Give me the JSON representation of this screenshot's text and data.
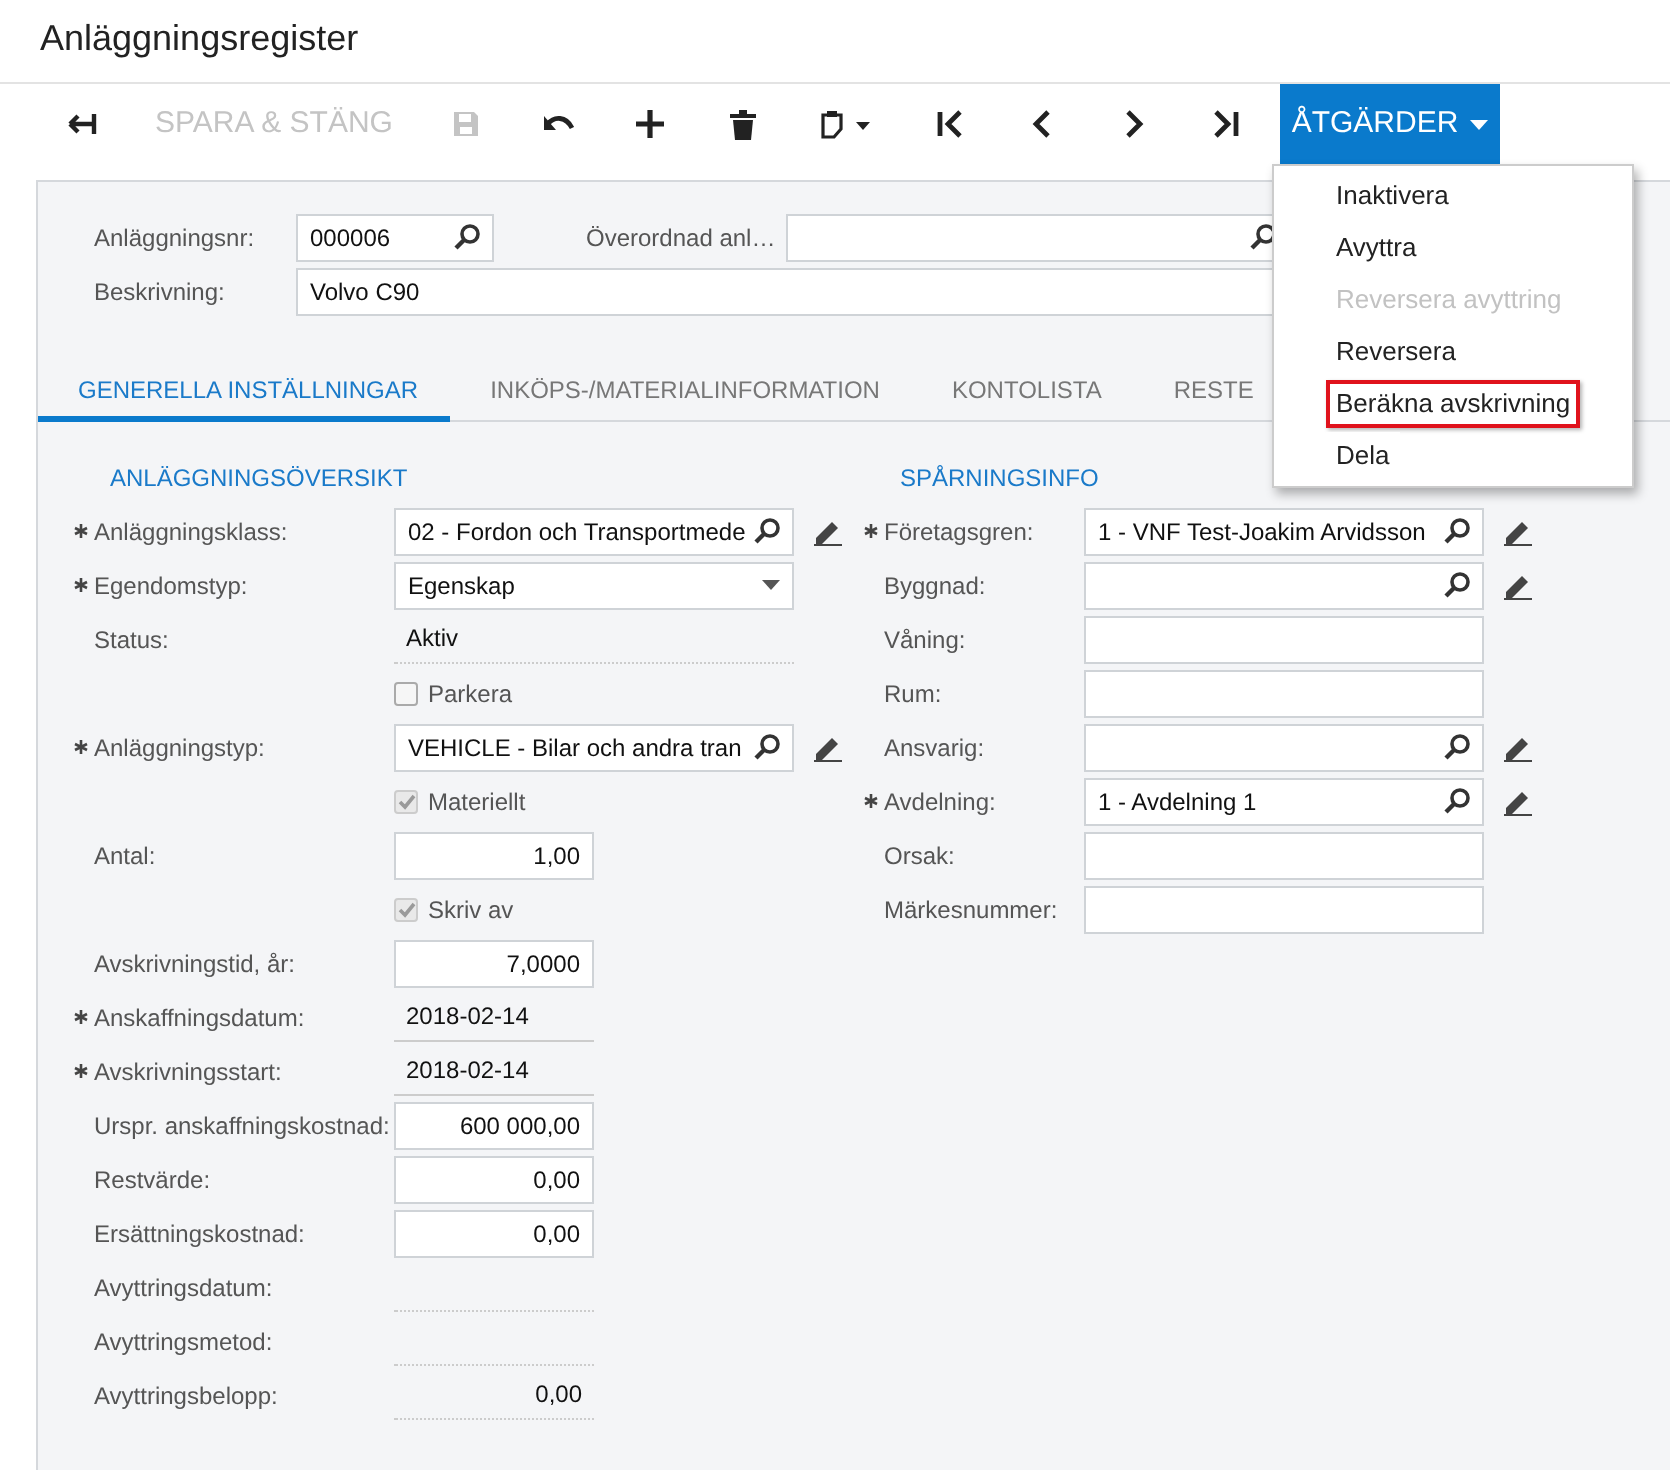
{
  "page_title": "Anläggningsregister",
  "toolbar": [
    {
      "kind": "back",
      "disabled": false
    },
    {
      "kind": "text",
      "label": "SPARA & STÄNG",
      "disabled": true
    },
    {
      "kind": "save",
      "disabled": true
    },
    {
      "kind": "undo",
      "disabled": false
    },
    {
      "kind": "add",
      "disabled": false
    },
    {
      "kind": "delete",
      "disabled": false
    },
    {
      "kind": "clipboard",
      "disabled": false
    },
    {
      "kind": "first",
      "disabled": false
    },
    {
      "kind": "prev",
      "disabled": false
    },
    {
      "kind": "next",
      "disabled": false
    },
    {
      "kind": "last",
      "disabled": false
    },
    {
      "kind": "menu",
      "label": "ÅTGÄRDER",
      "expanded": true
    }
  ],
  "actions_menu": [
    {
      "label": "Inaktivera",
      "disabled": false,
      "highlighted": false
    },
    {
      "label": "Avyttra",
      "disabled": false,
      "highlighted": false
    },
    {
      "label": "Reversera avyttring",
      "disabled": true,
      "highlighted": false
    },
    {
      "label": "Reversera",
      "disabled": false,
      "highlighted": false
    },
    {
      "label": "Beräkna avskrivning",
      "disabled": false,
      "highlighted": true
    },
    {
      "label": "Dela",
      "disabled": false,
      "highlighted": false
    }
  ],
  "header": {
    "asset_number": {
      "label": "Anläggningsnr:",
      "value": "000006"
    },
    "parent_asset": {
      "label": "Överordnad anl…"
    },
    "description": {
      "label": "Beskrivning:",
      "value": "Volvo C90"
    }
  },
  "tabs": [
    {
      "label": "GENERELLA INSTÄLLNINGAR",
      "selected": true
    },
    {
      "label": "INKÖPS-/MATERIALINFORMATION",
      "selected": false
    },
    {
      "label": "KONTOLISTA",
      "selected": false
    },
    {
      "label": "RESTE",
      "selected": false
    }
  ],
  "overview": {
    "title": "ANLÄGGNINGSÖVERSIKT",
    "rows": [
      {
        "kind": "lookup",
        "label": "Anläggningsklass:",
        "required": true,
        "value": "02 - Fordon och Transportmede",
        "editable": true
      },
      {
        "kind": "select",
        "label": "Egendomstyp:",
        "required": true,
        "value": "Egenskap"
      },
      {
        "kind": "readonly",
        "label": "Status:",
        "required": false,
        "value": "Aktiv"
      },
      {
        "kind": "checkbox",
        "label": "Parkera",
        "checked": false,
        "disabled": false
      },
      {
        "kind": "lookup",
        "label": "Anläggningstyp:",
        "required": true,
        "value": "VEHICLE - Bilar och andra tran",
        "editable": true
      },
      {
        "kind": "checkbox",
        "label": "Materiellt",
        "checked": true,
        "disabled": true
      },
      {
        "kind": "number",
        "label": "Antal:",
        "required": false,
        "value": "1,00"
      },
      {
        "kind": "checkbox",
        "label": "Skriv av",
        "checked": true,
        "disabled": true
      },
      {
        "kind": "number",
        "label": "Avskrivningstid, år:",
        "required": false,
        "value": "7,0000"
      },
      {
        "kind": "readonly",
        "label": "Anskaffningsdatum:",
        "required": true,
        "value": "2018-02-14"
      },
      {
        "kind": "readonly",
        "label": "Avskrivningsstart:",
        "required": true,
        "value": "2018-02-14"
      },
      {
        "kind": "number",
        "label": "Urspr. anskaffningskostnad:",
        "required": false,
        "value": "600 000,00"
      },
      {
        "kind": "number",
        "label": "Restvärde:",
        "required": false,
        "value": "0,00"
      },
      {
        "kind": "number",
        "label": "Ersättningskostnad:",
        "required": false,
        "value": "0,00"
      },
      {
        "kind": "readonly",
        "label": "Avyttringsdatum:",
        "required": false
      },
      {
        "kind": "readonly",
        "label": "Avyttringsmetod:",
        "required": false
      },
      {
        "kind": "readonly-number",
        "label": "Avyttringsbelopp:",
        "required": false,
        "value": "0,00"
      }
    ]
  },
  "tracking": {
    "title": "SPÅRNINGSINFO",
    "rows": [
      {
        "kind": "lookup",
        "label": "Företagsgren:",
        "required": true,
        "value": "1 - VNF Test-Joakim Arvidsson",
        "editable": true
      },
      {
        "kind": "lookup",
        "label": "Byggnad:",
        "required": false,
        "editable": true
      },
      {
        "kind": "text",
        "label": "Våning:",
        "required": false
      },
      {
        "kind": "text",
        "label": "Rum:",
        "required": false
      },
      {
        "kind": "lookup",
        "label": "Ansvarig:",
        "required": false,
        "editable": true
      },
      {
        "kind": "lookup",
        "label": "Avdelning:",
        "required": true,
        "value": "1 - Avdelning 1",
        "editable": true
      },
      {
        "kind": "text",
        "label": "Orsak:",
        "required": false
      },
      {
        "kind": "text",
        "label": "Märkesnummer:",
        "required": false
      }
    ]
  }
}
